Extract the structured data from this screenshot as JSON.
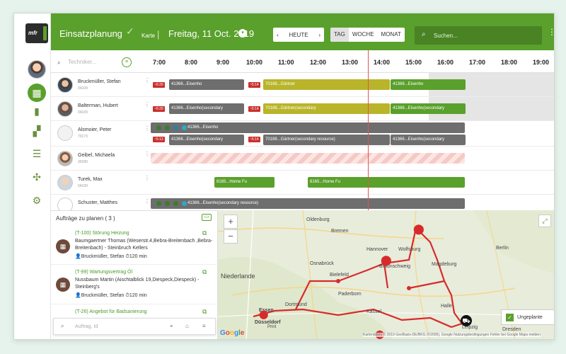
{
  "app": {
    "title": "Einsatzplanung",
    "map_label": "Karte",
    "date": "Freitag, 11 Oct. 2019",
    "logo": "mfr"
  },
  "nav": {
    "prev_icon": "‹",
    "today": "HEUTE",
    "next_icon": "›"
  },
  "views": {
    "day": "TAG",
    "week": "WOCHE",
    "month": "MONAT",
    "selected": "TAG"
  },
  "search": {
    "placeholder": "Suchen..."
  },
  "technician_search": {
    "placeholder": "Techniker..."
  },
  "hours": [
    "7:00",
    "8:00",
    "9:00",
    "10:00",
    "11:00",
    "12:00",
    "13:00",
    "14:00",
    "15:00",
    "16:00",
    "17:00",
    "18:00",
    "19:00"
  ],
  "workers": [
    {
      "name": "Bruckmüller, Stefan",
      "id": "04109"
    },
    {
      "name": "Balterman, Hubert",
      "id": "04109"
    },
    {
      "name": "Alsmoier, Peter",
      "id": "70173"
    },
    {
      "name": "Geibel, Michaela",
      "id": "35390"
    },
    {
      "name": "Turek, Max",
      "id": "04109"
    },
    {
      "name": "Schuster, Matthes",
      "id": ""
    }
  ],
  "bars": {
    "r0": [
      "41366...Eisenho",
      "70188...Gärtner",
      "41366...Eisenho"
    ],
    "r1": [
      "41366...Eisenho(secondary",
      "70188...Gärtner(secondary",
      "41366...Eisenho(secondary"
    ],
    "r2": [
      "41366...Eisenho"
    ],
    "r2b": [
      "41366...Eisenho(secondary",
      "70188...Gärtner(secondary resource)",
      "41366...Eisenho(secondary"
    ],
    "r4": [
      "8165...Home Fu",
      "8165...Home Fu"
    ],
    "r5": [
      "41366...Eisenho(secondary resource)"
    ]
  },
  "tags": [
    "~6:29",
    "~5:14",
    "~6:29",
    "~5:14",
    "~5:13",
    "~5:14"
  ],
  "orders": {
    "title": "Aufträge zu planen ( 3 )",
    "items": [
      {
        "title": "(T-100) Störung Heizung",
        "text": "Baumgaertner Thomas (Weserstr.4,Bebra-Breitenbach ,Bebra-Breitenbach) - Steinbruch Kellers",
        "worker": "Bruckmüller, Stefan",
        "duration": "120 min"
      },
      {
        "title": "(T-99) Wartungsvertrag Öl",
        "text": "Nussbaum Martin (Aischtalblick 19,Diespeck,Diespeck) - Steinberg's",
        "worker": "Bruckmüller, Stefan",
        "duration": "120 min"
      },
      {
        "title": "(T-26) Angebot für Badsanierung"
      }
    ]
  },
  "order_search": {
    "placeholder": "Auftrag, Id"
  },
  "map": {
    "cities": [
      "Oldenburg",
      "Bremen",
      "Hannover",
      "Wolfsburg",
      "Berlin",
      "Braunschweig",
      "Magdeburg",
      "Osnabrück",
      "Bielefeld",
      "Paderborn",
      "Kassel",
      "Essen",
      "Düsseldorf",
      "Dortmund",
      "Halle",
      "Leipzig",
      "Dresden",
      "Niederlande",
      "Print"
    ],
    "zoom_in": "+",
    "zoom_out": "−",
    "unplanned": "Ungeplante",
    "attribution": "Kartendaten © 2019 GeoBasis-DE/BKG (©2009), Google Nutzungsbedingungen Fehler bei Google Maps melden",
    "google": "Google"
  }
}
